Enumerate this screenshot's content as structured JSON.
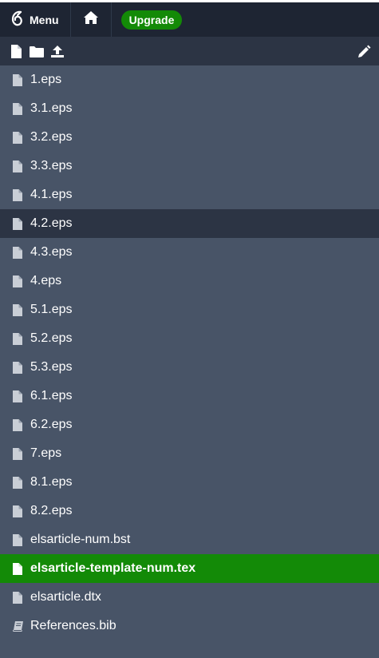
{
  "topbar": {
    "menu_label": "Menu",
    "upgrade_label": "Upgrade"
  },
  "colors": {
    "topbar_bg": "#1e2533",
    "panel_bg": "#485467",
    "selected_bg": "#2c3444",
    "active_bg": "#138a07"
  },
  "files": [
    {
      "name": "1.eps",
      "icon": "file-icon"
    },
    {
      "name": "3.1.eps",
      "icon": "file-icon"
    },
    {
      "name": "3.2.eps",
      "icon": "file-icon"
    },
    {
      "name": "3.3.eps",
      "icon": "file-icon"
    },
    {
      "name": "4.1.eps",
      "icon": "file-icon"
    },
    {
      "name": "4.2.eps",
      "icon": "file-icon"
    },
    {
      "name": "4.3.eps",
      "icon": "file-icon"
    },
    {
      "name": "4.eps",
      "icon": "file-icon"
    },
    {
      "name": "5.1.eps",
      "icon": "file-icon"
    },
    {
      "name": "5.2.eps",
      "icon": "file-icon"
    },
    {
      "name": "5.3.eps",
      "icon": "file-icon"
    },
    {
      "name": "6.1.eps",
      "icon": "file-icon"
    },
    {
      "name": "6.2.eps",
      "icon": "file-icon"
    },
    {
      "name": "7.eps",
      "icon": "file-icon"
    },
    {
      "name": "8.1.eps",
      "icon": "file-icon"
    },
    {
      "name": "8.2.eps",
      "icon": "file-icon"
    },
    {
      "name": "elsarticle-num.bst",
      "icon": "file-icon"
    },
    {
      "name": "elsarticle-template-num.tex",
      "icon": "file-icon"
    },
    {
      "name": "elsarticle.dtx",
      "icon": "file-icon"
    },
    {
      "name": "References.bib",
      "icon": "book-icon"
    }
  ]
}
